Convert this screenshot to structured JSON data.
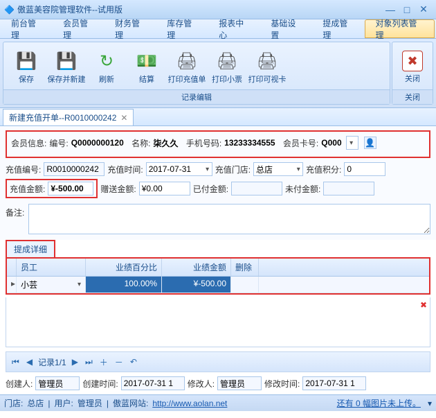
{
  "window": {
    "title": "傲蓝美容院管理软件--试用版"
  },
  "menu": {
    "items": [
      "前台管理",
      "会员管理",
      "财务管理",
      "库存管理",
      "报表中心",
      "基础设置",
      "提成管理",
      "对象列表管理"
    ],
    "active_index": 7
  },
  "ribbon": {
    "group_caption": "记录编辑",
    "close_caption": "关闭",
    "buttons": [
      {
        "label": "保存",
        "icon": "💾",
        "color": "#2e8b57"
      },
      {
        "label": "保存并新建",
        "icon": "💾",
        "color": "#1e70c9"
      },
      {
        "label": "刷新",
        "icon": "↻",
        "color": "#3aa63a"
      },
      {
        "label": "结算",
        "icon": "💵",
        "color": "#3aa63a"
      },
      {
        "label": "打印充值单",
        "icon": "🖨",
        "color": "#555"
      },
      {
        "label": "打印小票",
        "icon": "🖨",
        "color": "#555"
      },
      {
        "label": "打印可视卡",
        "icon": "🖨",
        "color": "#555"
      }
    ],
    "close_button": {
      "label": "关闭",
      "icon": "✖",
      "color": "#c0392b"
    }
  },
  "tab": {
    "title": "新建充值开单--R0010000242"
  },
  "member": {
    "label": "会员信息:",
    "bianhao_label": "编号:",
    "bianhao": "Q0000000120",
    "name_label": "名称:",
    "name": "柒久久",
    "phone_label": "手机号码:",
    "phone": "13233334555",
    "card_label": "会员卡号:",
    "card": "Q000"
  },
  "recharge": {
    "code_label": "充值编号:",
    "code": "R0010000242",
    "time_label": "充值时间:",
    "time": "2017-07-31",
    "store_label": "充值门店:",
    "store": "总店",
    "points_label": "充值积分:",
    "points": "0",
    "amount_label": "充值金额:",
    "amount": "¥-500.00",
    "gift_label": "赠送金额:",
    "gift": "¥0.00",
    "paid_label": "已付金额:",
    "paid": "",
    "unpaid_label": "未付金额:",
    "unpaid": "",
    "remark_label": "备注:"
  },
  "commission": {
    "tab_label": "提成详细",
    "headers": [
      "员工",
      "业绩百分比",
      "业绩金额",
      "删除"
    ],
    "rows": [
      {
        "emp": "小芸",
        "pct": "100.00%",
        "amt": "¥-500.00"
      }
    ],
    "delete_icon": "✖"
  },
  "nav": {
    "record_text": "记录1/1"
  },
  "meta": {
    "creator_label": "创建人:",
    "creator": "管理员",
    "ctime_label": "创建时间:",
    "ctime": "2017-07-31 1",
    "modifier_label": "修改人:",
    "modifier": "管理员",
    "mtime_label": "修改时间:",
    "mtime": "2017-07-31 1"
  },
  "status": {
    "store_label": "门店:",
    "store": "总店",
    "user_label": "用户:",
    "user": "管理员",
    "site_label": "傲蓝网站:",
    "site_url": "http://www.aolan.net",
    "upload_text": "还有 0 幅图片未上传。"
  }
}
